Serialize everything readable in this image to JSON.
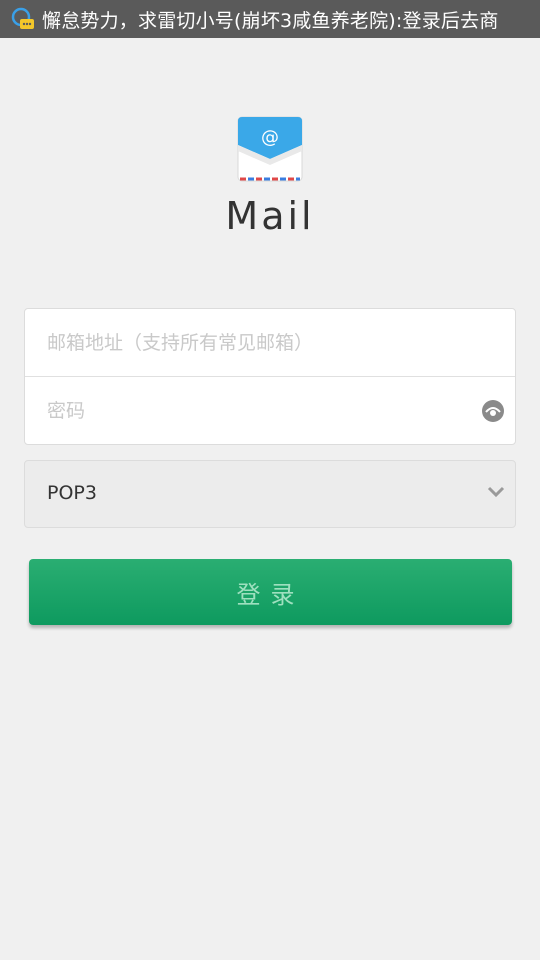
{
  "status_bar": {
    "notification_text": "懈怠势力，求雷切小号(崩坏3咸鱼养老院):登录后去商"
  },
  "app": {
    "title": "Mail",
    "logo_icon": "mail-envelope-icon"
  },
  "form": {
    "email_placeholder": "邮箱地址（支持所有常见邮箱）",
    "email_value": "",
    "password_placeholder": "密码",
    "password_value": "",
    "protocol_selected": "POP3",
    "login_label": "登录"
  },
  "colors": {
    "status_bar_bg": "#5a5a5a",
    "page_bg": "#f0f0f0",
    "login_button": "#13a065",
    "logo_blue": "#3aa8e8"
  }
}
